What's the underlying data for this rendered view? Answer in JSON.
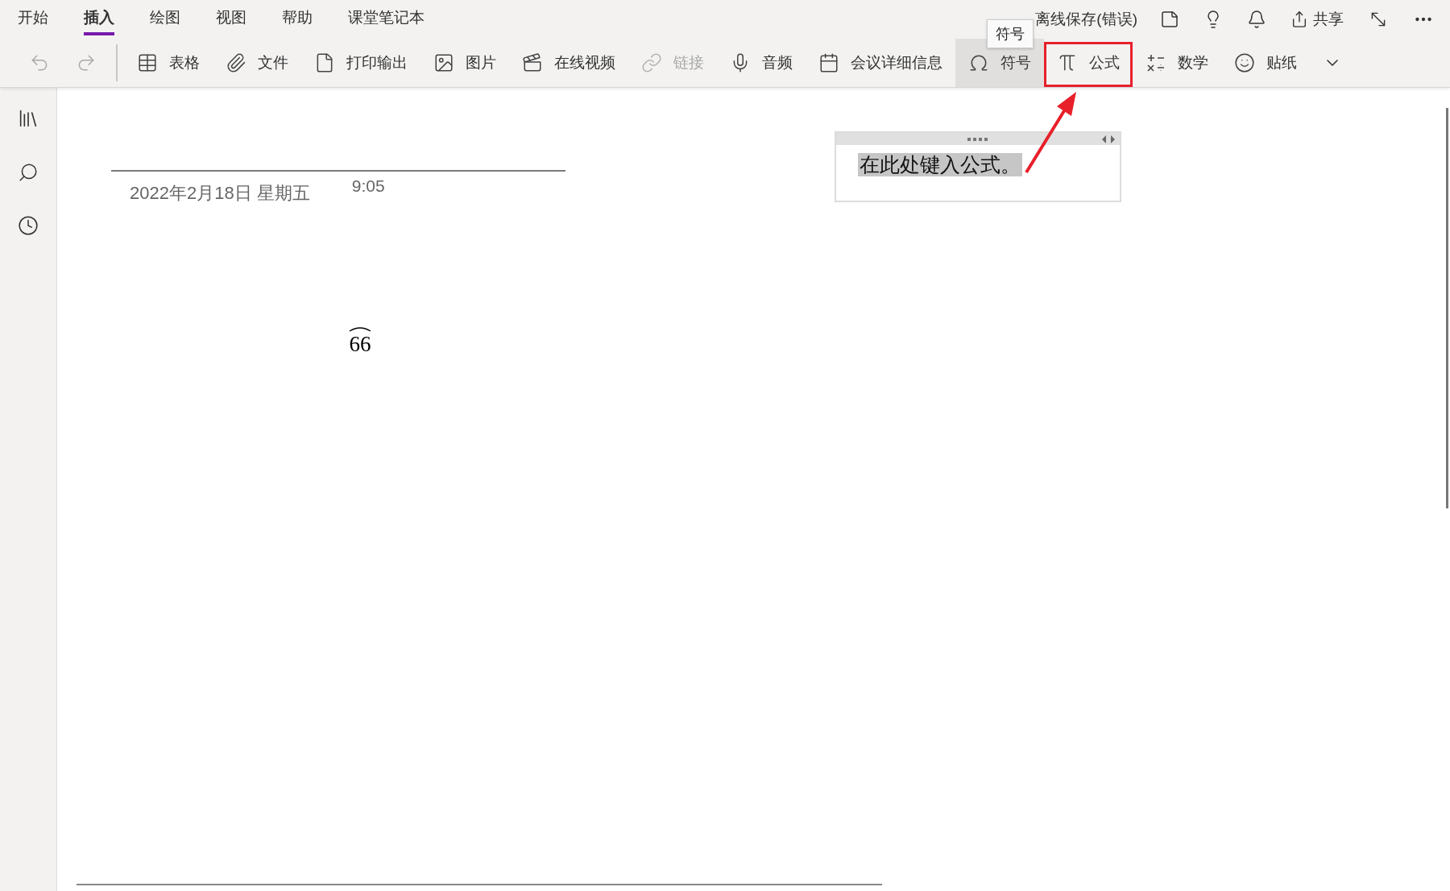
{
  "menu_tabs": [
    {
      "label": "开始",
      "selected": false
    },
    {
      "label": "插入",
      "selected": true
    },
    {
      "label": "绘图",
      "selected": false
    },
    {
      "label": "视图",
      "selected": false
    },
    {
      "label": "帮助",
      "selected": false
    },
    {
      "label": "课堂笔记本",
      "selected": false
    }
  ],
  "sync_status": "离线保存(错误)",
  "share_label": "共享",
  "tooltip": "符号",
  "toolbar": {
    "undo_disabled": true,
    "redo_disabled": true,
    "items": [
      {
        "label": "表格",
        "disabled": false,
        "hovered": false,
        "annotated": false
      },
      {
        "label": "文件",
        "disabled": false,
        "hovered": false,
        "annotated": false
      },
      {
        "label": "打印输出",
        "disabled": false,
        "hovered": false,
        "annotated": false
      },
      {
        "label": "图片",
        "disabled": false,
        "hovered": false,
        "annotated": false
      },
      {
        "label": "在线视频",
        "disabled": false,
        "hovered": false,
        "annotated": false
      },
      {
        "label": "链接",
        "disabled": true,
        "hovered": false,
        "annotated": false
      },
      {
        "label": "音频",
        "disabled": false,
        "hovered": false,
        "annotated": false
      },
      {
        "label": "会议详细信息",
        "disabled": false,
        "hovered": false,
        "annotated": false
      },
      {
        "label": "符号",
        "disabled": false,
        "hovered": true,
        "annotated": false
      },
      {
        "label": "公式",
        "disabled": false,
        "hovered": false,
        "annotated": true
      },
      {
        "label": "数学",
        "disabled": false,
        "hovered": false,
        "annotated": false
      },
      {
        "label": "贴纸",
        "disabled": false,
        "hovered": false,
        "annotated": false
      }
    ]
  },
  "page": {
    "date": "2022年2月18日 星期五",
    "time": "9:05",
    "equation": "66",
    "equation_box": {
      "placeholder": "在此处键入公式。",
      "selected": true
    }
  }
}
